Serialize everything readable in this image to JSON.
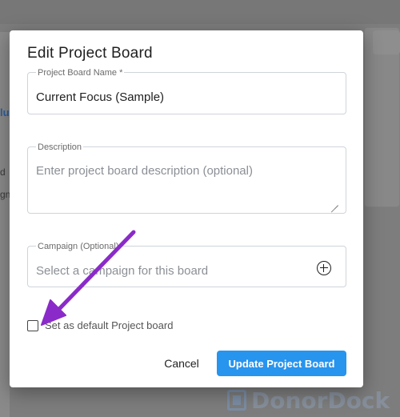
{
  "background": {
    "fragments": [
      "lul",
      "d",
      "gn"
    ],
    "watermark_text": "DonorDock"
  },
  "modal": {
    "title": "Edit Project Board",
    "name_field": {
      "label": "Project Board Name *",
      "value": "Current Focus (Sample)"
    },
    "description_field": {
      "label": "Description",
      "placeholder": "Enter project board description (optional)"
    },
    "campaign_field": {
      "label": "Campaign (Optional)",
      "placeholder": "Select a campaign for this board",
      "icon": "plus-circle-icon"
    },
    "default_checkbox": {
      "label": "Set as default Project board",
      "checked": false
    },
    "cancel_label": "Cancel",
    "submit_label": "Update Project Board"
  },
  "colors": {
    "primary_button": "#2794ee",
    "annotation_arrow": "#8a2bc9",
    "overlay": "#7d7d7d"
  }
}
